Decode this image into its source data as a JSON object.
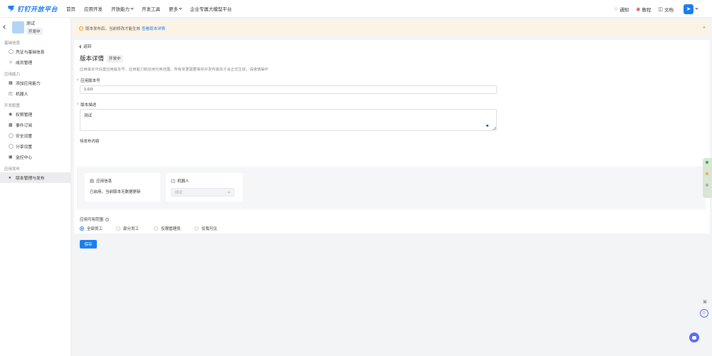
{
  "topbar": {
    "logo_text": "钉钉开放平台",
    "nav": [
      "首页",
      "应用开发",
      "开放能力",
      "开发工具",
      "更多",
      "企业专属大模型平台"
    ],
    "nav_dropdowns": [
      false,
      false,
      true,
      false,
      true,
      false
    ],
    "notify": "通知",
    "tutorial": "教程",
    "docs": "文档"
  },
  "sidebar": {
    "app_name": "测试",
    "app_status": "开发中",
    "groups": [
      {
        "title": "基础信息",
        "items": [
          {
            "label": "凭证与基础信息",
            "icon": "key-icon"
          },
          {
            "label": "成员管理",
            "icon": "user-icon"
          }
        ]
      },
      {
        "title": "应用能力",
        "items": [
          {
            "label": "添加应用能力",
            "icon": "grid-add-icon"
          },
          {
            "label": "机器人",
            "icon": "robot-icon"
          }
        ]
      },
      {
        "title": "开发配置",
        "items": [
          {
            "label": "权限管理",
            "icon": "permission-icon"
          },
          {
            "label": "事件订阅",
            "icon": "event-icon"
          },
          {
            "label": "安全设置",
            "icon": "shield-icon"
          },
          {
            "label": "分享设置",
            "icon": "share-icon"
          },
          {
            "label": "监控中心",
            "icon": "monitor-icon"
          }
        ]
      },
      {
        "title": "应用发布",
        "items": [
          {
            "label": "版本管理与发布",
            "icon": "publish-icon",
            "active": true
          }
        ]
      }
    ]
  },
  "notice": {
    "text": "版本发布后，当前修改才能生效",
    "link": "查看版本详情"
  },
  "page": {
    "back": "返回",
    "title": "版本详情",
    "status": "开发中",
    "description": "应用版本可设置应用版本号、应用能力和应用可用范围，所有变更需要保存并发布版本才会正式生效，请谨慎操作"
  },
  "form": {
    "version_label": "应用版本号",
    "version_value": "1.0.0",
    "desc_label": "版本描述",
    "desc_value": "测试",
    "release_label": "待发布内容",
    "app_info_title": "应用信息",
    "app_info_body": "已启用，当前版本无数据更新",
    "robot_title": "机器人",
    "robot_select": "测试",
    "scope_label": "应用可用范围",
    "scope_options": [
      {
        "label": "全部员工",
        "checked": true
      },
      {
        "label": "部分员工",
        "checked": false
      },
      {
        "label": "仅限管理员",
        "checked": false
      },
      {
        "label": "仅我可见",
        "checked": false
      }
    ],
    "save": "保存"
  },
  "colors": {
    "brand": "#1a7ef2",
    "notice_bg": "#fdf3e4",
    "required": "#e64545"
  }
}
